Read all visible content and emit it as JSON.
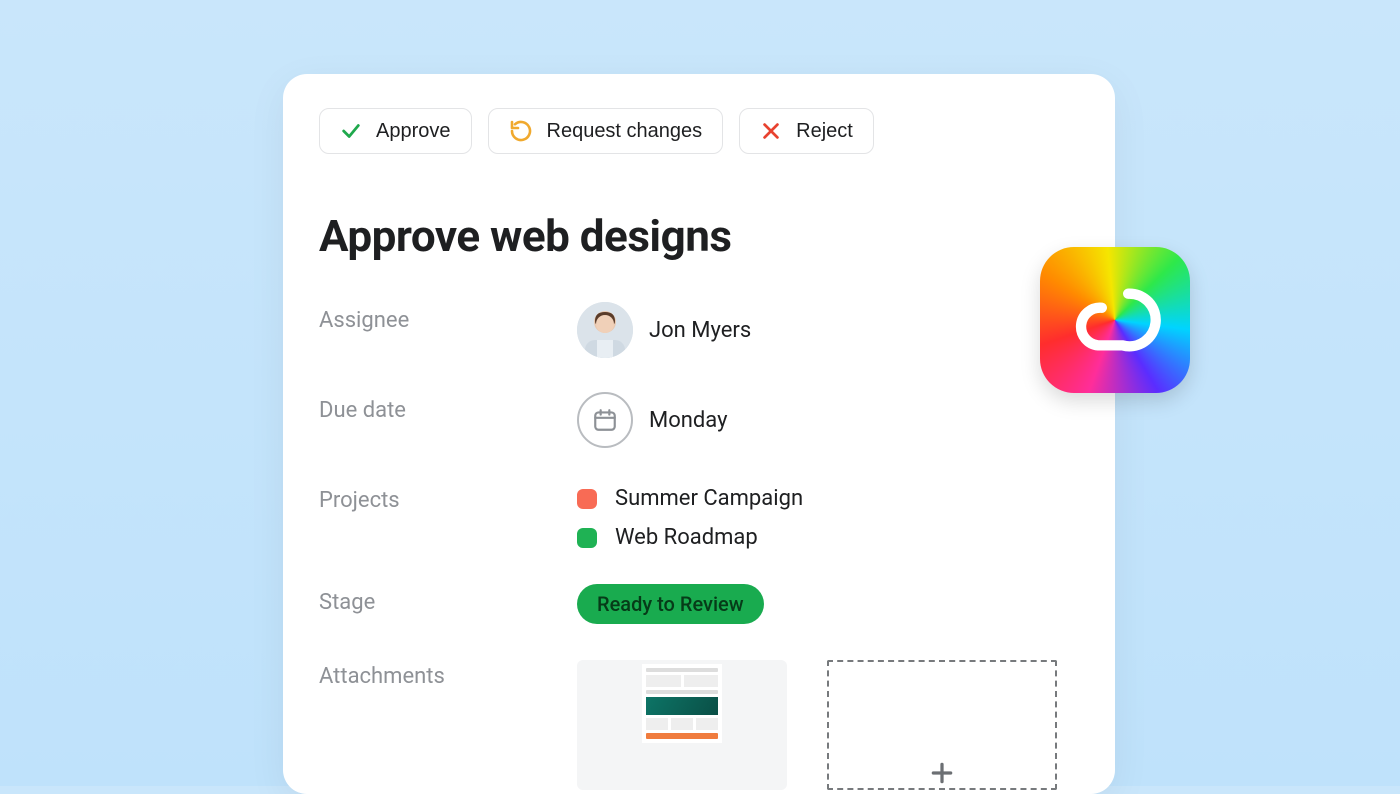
{
  "actions": {
    "approve": "Approve",
    "request_changes": "Request changes",
    "reject": "Reject"
  },
  "task": {
    "title": "Approve web designs"
  },
  "fields": {
    "assignee": {
      "label": "Assignee",
      "name": "Jon Myers"
    },
    "due_date": {
      "label": "Due date",
      "value": "Monday"
    },
    "projects": {
      "label": "Projects",
      "items": [
        {
          "name": "Summer Campaign",
          "color": "#f86b55"
        },
        {
          "name": "Web Roadmap",
          "color": "#1fb254"
        }
      ]
    },
    "stage": {
      "label": "Stage",
      "value": "Ready to Review"
    },
    "attachments": {
      "label": "Attachments"
    }
  },
  "integration_badge": "adobe-creative-cloud"
}
